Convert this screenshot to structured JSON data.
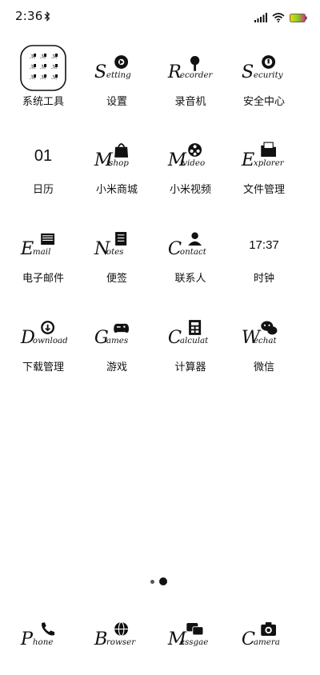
{
  "status": {
    "time": "2:36"
  },
  "rows": [
    [
      {
        "label": "系统工具",
        "icon": "system-tools-folder-icon"
      },
      {
        "label": "设置",
        "icon": "settings-icon",
        "logo_cap": "S",
        "logo_rest": "etting"
      },
      {
        "label": "录音机",
        "icon": "recorder-icon",
        "logo_cap": "R",
        "logo_rest": "ecorder"
      },
      {
        "label": "安全中心",
        "icon": "security-icon",
        "logo_cap": "S",
        "logo_rest": "ecurity"
      }
    ],
    [
      {
        "label": "日历",
        "icon": "calendar-icon",
        "text": "01"
      },
      {
        "label": "小米商城",
        "icon": "mishop-icon",
        "logo_cap": "M",
        "logo_rest": "ishop"
      },
      {
        "label": "小米视频",
        "icon": "mivideo-icon",
        "logo_cap": "M",
        "logo_rest": "ivideo"
      },
      {
        "label": "文件管理",
        "icon": "explorer-icon",
        "logo_cap": "E",
        "logo_rest": "xplorer"
      }
    ],
    [
      {
        "label": "电子邮件",
        "icon": "email-icon",
        "logo_cap": "E",
        "logo_rest": "mail"
      },
      {
        "label": "便签",
        "icon": "notes-icon",
        "logo_cap": "N",
        "logo_rest": "otes"
      },
      {
        "label": "联系人",
        "icon": "contact-icon",
        "logo_cap": "C",
        "logo_rest": "ontact"
      },
      {
        "label": "时钟",
        "icon": "clock-icon",
        "text": "17:37"
      }
    ],
    [
      {
        "label": "下载管理",
        "icon": "download-icon",
        "logo_cap": "D",
        "logo_rest": "ownload"
      },
      {
        "label": "游戏",
        "icon": "games-icon",
        "logo_cap": "G",
        "logo_rest": "ames"
      },
      {
        "label": "计算器",
        "icon": "calculator-icon",
        "logo_cap": "C",
        "logo_rest": "alculat"
      },
      {
        "label": "微信",
        "icon": "wechat-icon",
        "logo_cap": "W",
        "logo_rest": "echat"
      }
    ]
  ],
  "dock": [
    {
      "icon": "phone-icon",
      "logo_cap": "P",
      "logo_rest": "hone"
    },
    {
      "icon": "browser-icon",
      "logo_cap": "B",
      "logo_rest": "rowser"
    },
    {
      "icon": "message-icon",
      "logo_cap": "M",
      "logo_rest": "essgae"
    },
    {
      "icon": "camera-icon",
      "logo_cap": "C",
      "logo_rest": "amera"
    }
  ],
  "pager": {
    "pages": 2,
    "current": 2
  },
  "colors": {
    "battery_start": "#ffd400",
    "battery_end": "#e0307a"
  }
}
